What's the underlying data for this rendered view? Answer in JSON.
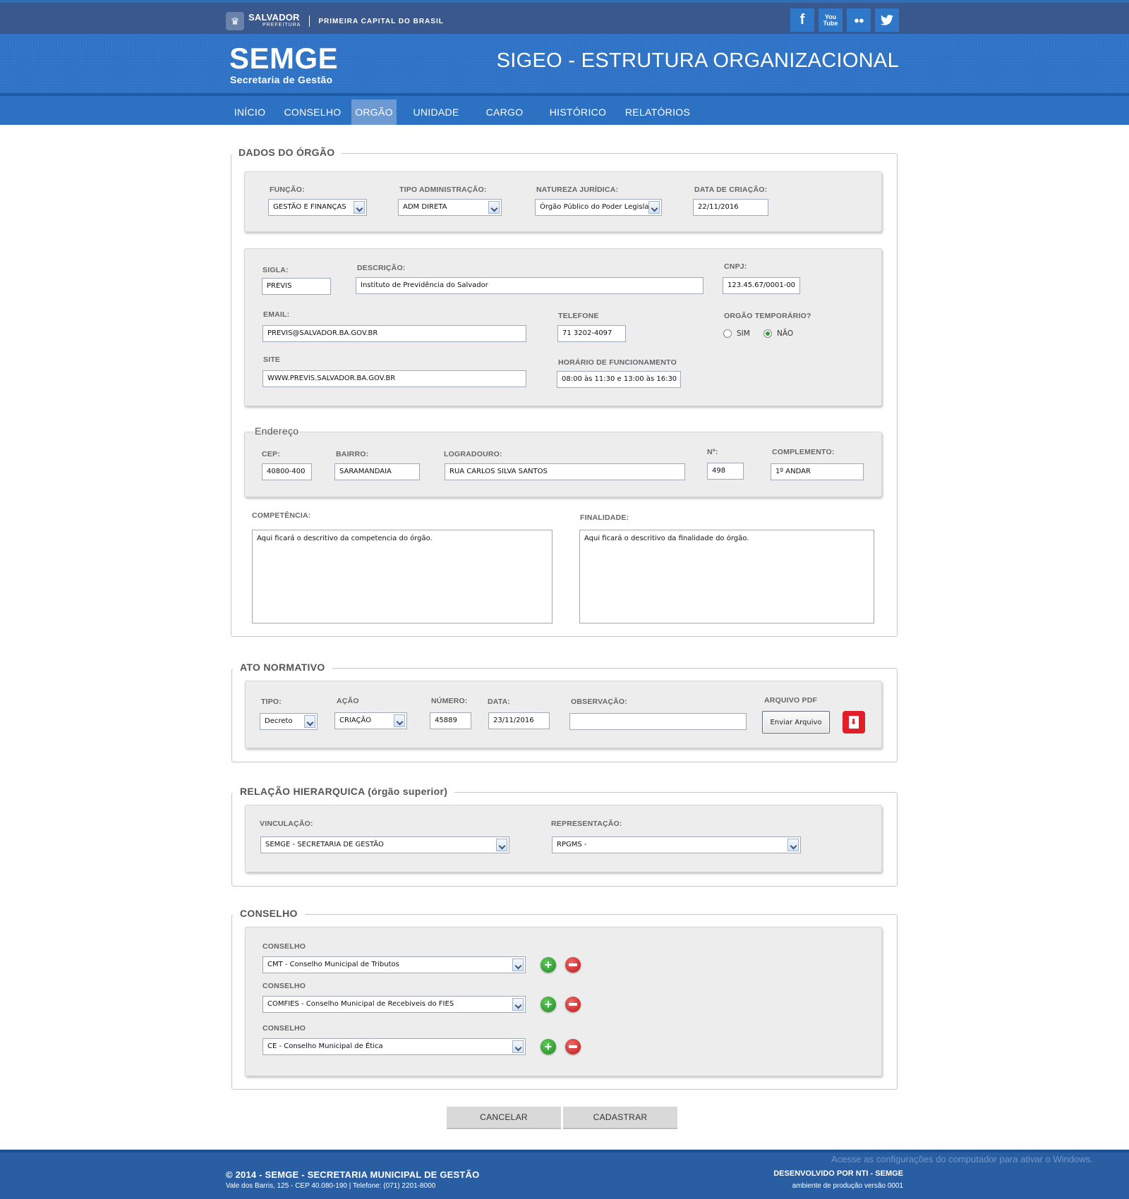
{
  "header": {
    "logo_name": "SALVADOR",
    "logo_sub": "PREFEITURA",
    "slogan": "PRIMEIRA CAPITAL DO BRASIL",
    "brand_title": "SEMGE",
    "brand_subtitle": "Secretaria de Gestão",
    "system_title": "SIGEO - ESTRUTURA ORGANIZACIONAL",
    "social": [
      "facebook-icon",
      "youtube-icon",
      "flickr-icon",
      "twitter-icon"
    ],
    "youtube_text": "You Tube"
  },
  "nav": [
    {
      "label": "INÍCIO"
    },
    {
      "label": "CONSELHO"
    },
    {
      "label": "ORGÃO",
      "active": true
    },
    {
      "label": "UNIDADE"
    },
    {
      "label": "CARGO"
    },
    {
      "label": "HISTÓRICO"
    },
    {
      "label": "RELATÓRIOS"
    }
  ],
  "dados_orgao": {
    "legend": "DADOS DO ÓRGÃO",
    "funcao_label": "FUNÇÃO:",
    "funcao_value": "GESTÃO E FINANÇAS",
    "tipo_admin_label": "TIPO ADMINISTRAÇÃO:",
    "tipo_admin_value": "ADM DIRETA",
    "natureza_label": "NATUREZA JURÍDICA:",
    "natureza_value": "Órgão Público do Poder Legisla",
    "data_criacao_label": "DATA DE CRIAÇÃO:",
    "data_criacao_value": "22/11/2016",
    "sigla_label": "SIGLA:",
    "sigla_value": "PREVIS",
    "descricao_label": "DESCRIÇÃO:",
    "descricao_value": "Instituto de Previdência do  Salvador",
    "cnpj_label": "CNPJ:",
    "cnpj_value": "123.45.67/0001-00",
    "email_label": "EMAIL:",
    "email_value": "PREVIS@SALVADOR.BA.GOV.BR",
    "telefone_label": "TELEFONE",
    "telefone_value": "71 3202-4097",
    "temporario_label": "ORGÃO TEMPORÁRIO?",
    "temporario_sim": "SIM",
    "temporario_nao": "NÃO",
    "temporario_selected": "NÃO",
    "site_label": "SITE",
    "site_value": "WWW.PREVIS.SALVADOR.BA.GOV.BR",
    "horario_label": "HORÁRIO DE FUNCIONAMENTO",
    "horario_value": "08:00 às 11:30 e 13:00 às 16:30"
  },
  "endereco": {
    "legend": "Endereço",
    "cep_label": "CEP:",
    "cep_value": "40800-400",
    "bairro_label": "BAIRRO:",
    "bairro_value": "SARAMANDAIA",
    "logradouro_label": "LOGRADOURO:",
    "logradouro_value": "RUA CARLOS SILVA SANTOS",
    "numero_label": "Nº:",
    "numero_value": "498",
    "complemento_label": "COMPLEMENTO:",
    "complemento_value": "1º ANDAR"
  },
  "textos": {
    "competencia_label": "COMPETÊNCIA:",
    "competencia_value": "Aqui ficará o descritivo da competencia do órgão.",
    "finalidade_label": "FINALIDADE:",
    "finalidade_value": "Aqui ficará o descritivo da finalidade do órgão."
  },
  "ato_normativo": {
    "legend": "ATO NORMATIVO",
    "tipo_label": "TIPO:",
    "tipo_value": "Decreto",
    "acao_label": "AÇÃO",
    "acao_value": "CRIAÇÃO",
    "numero_label": "NÚMERO:",
    "numero_value": "45889",
    "data_label": "DATA:",
    "data_value": "23/11/2016",
    "observacao_label": "OBSERVAÇÃO:",
    "observacao_value": "",
    "arquivo_label": "ARQUIVO PDF",
    "enviar_label": "Enviar Arquivo"
  },
  "relacao": {
    "legend": "RELAÇÃO HIERARQUICA (órgão superior)",
    "vinculacao_label": "VINCULAÇÃO:",
    "vinculacao_value": "SEMGE - SECRETARIA DE GESTÃO",
    "representacao_label": "REPRESENTAÇÃO:",
    "representacao_value": "RPGMS -"
  },
  "conselho": {
    "legend": "CONSELHO",
    "items": [
      {
        "label": "CONSELHO",
        "value": "CMT - Conselho Municipal de Tributos"
      },
      {
        "label": "CONSELHO",
        "value": "COMFIES - Conselho Municipal de Recebiveis do FIES"
      },
      {
        "label": "CONSELHO",
        "value": "CE - Conselho Municipal de Ética"
      }
    ]
  },
  "actions": {
    "cancelar": "CANCELAR",
    "cadastrar": "CADASTRAR"
  },
  "footer": {
    "copyright": "© 2014 - SEMGE - SECRETARIA MUNICIPAL DE GESTÃO",
    "address": "Vale dos Barris, 125 - CEP 40.080-190 | Telefone: (071) 2201-8000",
    "developer": "DESENVOLVIDO POR NTI - SEMGE",
    "environment": "ambiente de produção versão 0001",
    "watermark": "Acesse as configurações do computador para ativar o Windows."
  }
}
